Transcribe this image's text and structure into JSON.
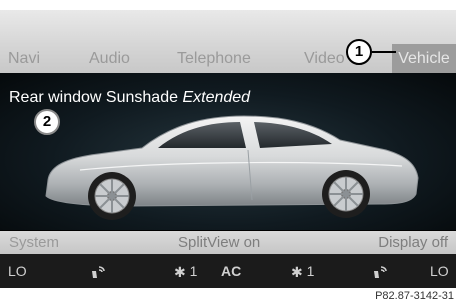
{
  "tabs": [
    "Navi",
    "Audio",
    "Telephone",
    "Video",
    "Vehicle"
  ],
  "selected_tab": "Vehicle",
  "callouts": [
    "1",
    "2"
  ],
  "status": {
    "prefix": "Rear window Sunshade",
    "value": "Extended"
  },
  "bottom_bar": {
    "left": "System",
    "center": "SplitView on",
    "right": "Display off"
  },
  "climate": {
    "left_temp": "LO",
    "left_fan": "1",
    "ac": "AC",
    "right_fan": "1",
    "right_temp": "LO",
    "icons": [
      "seat-airflow-icon",
      "fan-icon",
      "fan-icon",
      "seat-airflow-icon"
    ]
  },
  "figure_ref": "P82.87-3142-31"
}
